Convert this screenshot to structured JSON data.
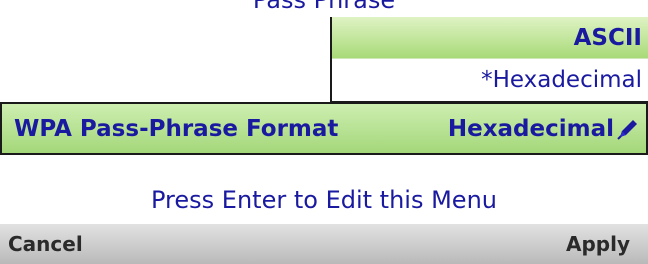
{
  "header": {
    "title": "Pass Phrase"
  },
  "dropdown": {
    "options": [
      {
        "label": "ASCII",
        "selected": true
      },
      {
        "label": "*Hexadecimal",
        "selected": false
      }
    ]
  },
  "setting": {
    "label": "WPA Pass-Phrase Format",
    "value": "Hexadecimal",
    "edit_icon": "pencil-icon"
  },
  "hint": "Press Enter to Edit this Menu",
  "softkeys": {
    "left": "Cancel",
    "right": "Apply"
  },
  "colors": {
    "text": "#1a1aa0",
    "highlight_light": "#dff3c4",
    "highlight_dark": "#a4d77a",
    "softkey_bg": "#c8c8c8"
  }
}
